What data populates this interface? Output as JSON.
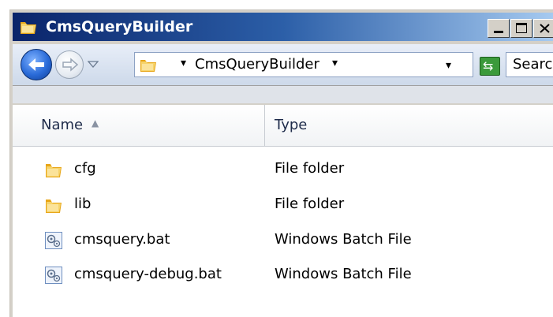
{
  "window": {
    "title": "CmsQueryBuilder",
    "controls": {
      "minimize": "minimize-icon",
      "maximize": "maximize-icon",
      "close": "close-icon"
    }
  },
  "navigation": {
    "back": "back-arrow-icon",
    "forward": "forward-arrow-icon",
    "breadcrumb": "CmsQueryBuilder",
    "search_placeholder": "Search"
  },
  "file_list": {
    "columns": [
      {
        "label": "Name",
        "sort": "ascending"
      },
      {
        "label": "Type"
      }
    ],
    "rows": [
      {
        "name": "cfg",
        "type": "File folder",
        "icon": "folder-icon"
      },
      {
        "name": "lib",
        "type": "File folder",
        "icon": "folder-icon"
      },
      {
        "name": "cmsquery.bat",
        "type": "Windows Batch File",
        "icon": "batch-file-icon"
      },
      {
        "name": "cmsquery-debug.bat",
        "type": "Windows Batch File",
        "icon": "batch-file-icon"
      }
    ]
  },
  "colors": {
    "title_bar_start": "#0a246a",
    "title_bar_end": "#a6caf0",
    "back_button": "#2a6bd8",
    "refresh_button": "#3b9a3b",
    "folder": "#f3c43a"
  }
}
